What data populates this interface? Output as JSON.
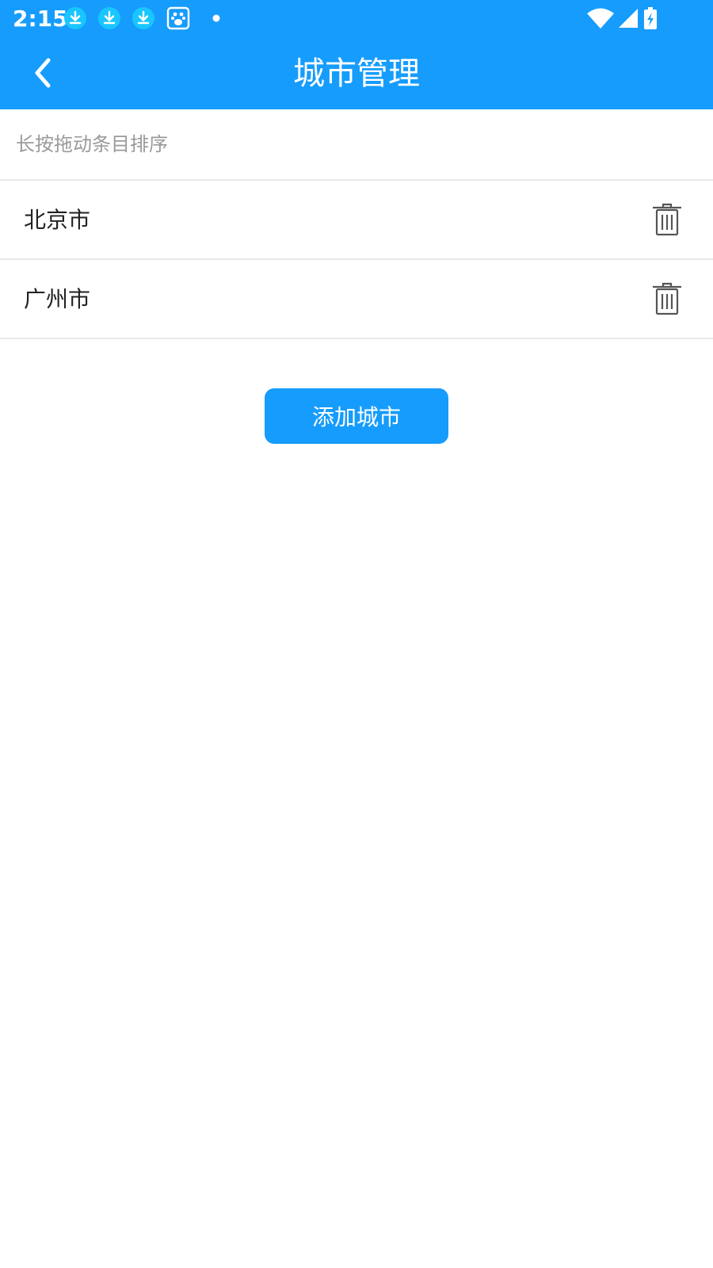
{
  "status_bar": {
    "time": "2:15",
    "notification_icons": [
      "download-icon",
      "download-icon",
      "download-icon",
      "baidu-paw-icon",
      "dot-icon"
    ],
    "system_icons": [
      "wifi-icon",
      "cell-signal-icon",
      "battery-charging-icon"
    ]
  },
  "header": {
    "title": "城市管理",
    "back_icon": "chevron-left-icon"
  },
  "hint": {
    "text": "长按拖动条目排序"
  },
  "cities": [
    {
      "name": "北京市",
      "delete_icon": "trash-icon"
    },
    {
      "name": "广州市",
      "delete_icon": "trash-icon"
    }
  ],
  "add_button": {
    "label": "添加城市"
  },
  "colors": {
    "primary": "#169cfc",
    "divider": "#e8e8e8",
    "hint_text": "#9a9a9a",
    "body_text": "#222222"
  }
}
